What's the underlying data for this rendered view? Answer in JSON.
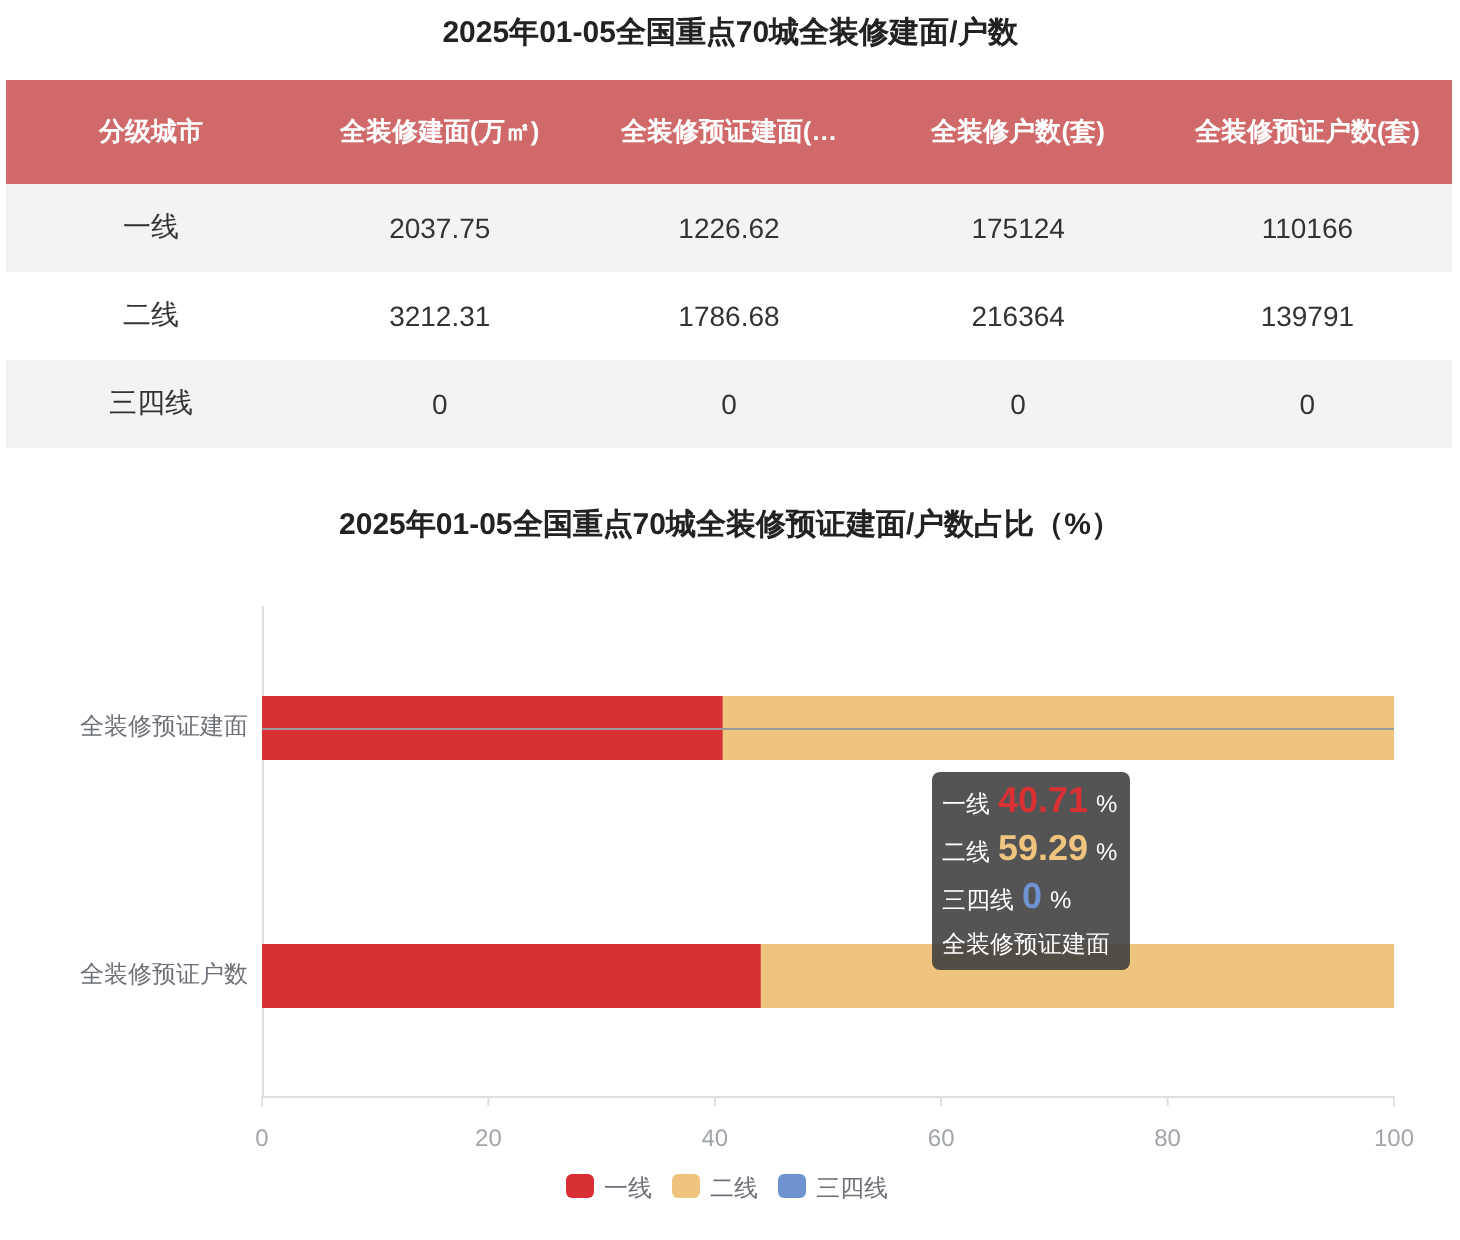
{
  "table_title": "2025年01-05全国重点70城全装修建面/户数",
  "table": {
    "columns": [
      "分级城市",
      "全装修建面(万㎡)",
      "全装修预证建面(…",
      "全装修户数(套)",
      "全装修预证户数(套)"
    ],
    "rows": [
      [
        "一线",
        "2037.75",
        "1226.62",
        "175124",
        "110166"
      ],
      [
        "二线",
        "3212.31",
        "1786.68",
        "216364",
        "139791"
      ],
      [
        "三四线",
        "0",
        "0",
        "0",
        "0"
      ]
    ]
  },
  "chart_data": {
    "type": "bar",
    "orientation": "horizontal",
    "stacked": true,
    "title": "2025年01-05全国重点70城全装修预证建面/户数占比（%）",
    "categories": [
      "全装修预证建面",
      "全装修预证户数"
    ],
    "series": [
      {
        "name": "一线",
        "color": "#d93035",
        "values": [
          40.71,
          44.07
        ]
      },
      {
        "name": "二线",
        "color": "#efc47e",
        "values": [
          59.29,
          55.93
        ]
      },
      {
        "name": "三四线",
        "color": "#6f93d0",
        "values": [
          0,
          0
        ]
      }
    ],
    "xlim": [
      0,
      100
    ],
    "xticks": [
      0,
      20,
      40,
      60,
      80,
      100
    ],
    "legend": true
  },
  "tooltip": {
    "rows": [
      {
        "label": "一线",
        "value": "40.71",
        "unit": "%",
        "color": "#d93035"
      },
      {
        "label": "二线",
        "value": "59.29",
        "unit": "%",
        "color": "#efc47e"
      },
      {
        "label": "三四线",
        "value": "0",
        "unit": "%",
        "color": "#6f93d0"
      }
    ],
    "title": "全装修预证建面"
  }
}
